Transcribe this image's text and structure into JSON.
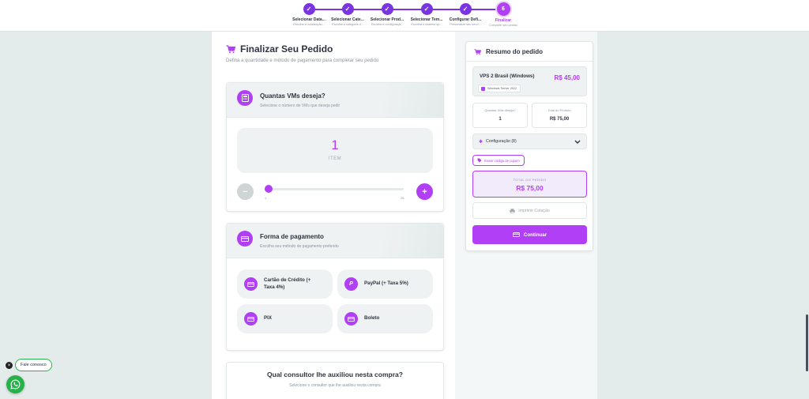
{
  "colors": {
    "accent": "#b03ff5",
    "stepper": "#7a33e0",
    "whatsapp": "#27b14b"
  },
  "stepper": {
    "steps": [
      {
        "label": "Selecionar Data...",
        "sub": "Escolha a localização...",
        "mark": "✓"
      },
      {
        "label": "Selecionar Cate...",
        "sub": "Escolha a categoria d...",
        "mark": "✓"
      },
      {
        "label": "Selecionar Prod...",
        "sub": "Escolha a configuraçã...",
        "mark": "✓"
      },
      {
        "label": "Selecionar Tem...",
        "sub": "Escolha o sistema op...",
        "mark": "✓"
      },
      {
        "label": "Configurar Defi...",
        "sub": "Personalize seu servi...",
        "mark": "✓"
      },
      {
        "label": "Finalizar",
        "sub": "Complete seu pedido",
        "mark": "6"
      }
    ]
  },
  "page": {
    "title": "Finalizar Seu Pedido",
    "subtitle": "Defina a quantidade e método de pagamento para completar seu pedido"
  },
  "quantity": {
    "title": "Quantas VMs deseja?",
    "subtitle": "Selecione o número de VMs que deseja pedir",
    "value": "1",
    "unit": "ITEM",
    "minus": "−",
    "plus": "+",
    "slider_min": "1",
    "slider_max": "25",
    "slider_value": 1
  },
  "payment": {
    "title": "Forma de pagamento",
    "subtitle": "Escolha seu método de pagamento preferido",
    "options": [
      {
        "label": "Cartão de Crédito (+ Taxa 4%)",
        "icon": "credit-card-icon"
      },
      {
        "label": "PayPal (+ Taxa 5%)",
        "icon": "paypal-icon"
      },
      {
        "label": "PIX",
        "icon": "pix-icon"
      },
      {
        "label": "Boleto",
        "icon": "boleto-icon"
      }
    ]
  },
  "consultant": {
    "title": "Qual consultor lhe auxiliou nesta compra?",
    "subtitle": "Selecione o consultor que lhe auxiliou nesta compra"
  },
  "summary": {
    "title": "Resumo do pedido",
    "product_name": "VPS 2 Brasil (Windows)",
    "product_price": "R$ 45,00",
    "os": "Windows Server 2022",
    "vm_qty_label": "Quantas VMs deseja?",
    "vm_qty_value": "1",
    "product_total_label": "Total do Produto",
    "product_total_value": "R$ 75,00",
    "config_label": "Configuração (8)",
    "coupon_label": "Inserir código de cupom",
    "total_label": "TOTAL DO PEDIDO",
    "total_value": "R$ 75,00",
    "print_label": "Imprimir Cotação",
    "continue_label": "Continuar"
  },
  "widgets": {
    "fale_conosco": "Fale conosco",
    "close": "×"
  }
}
